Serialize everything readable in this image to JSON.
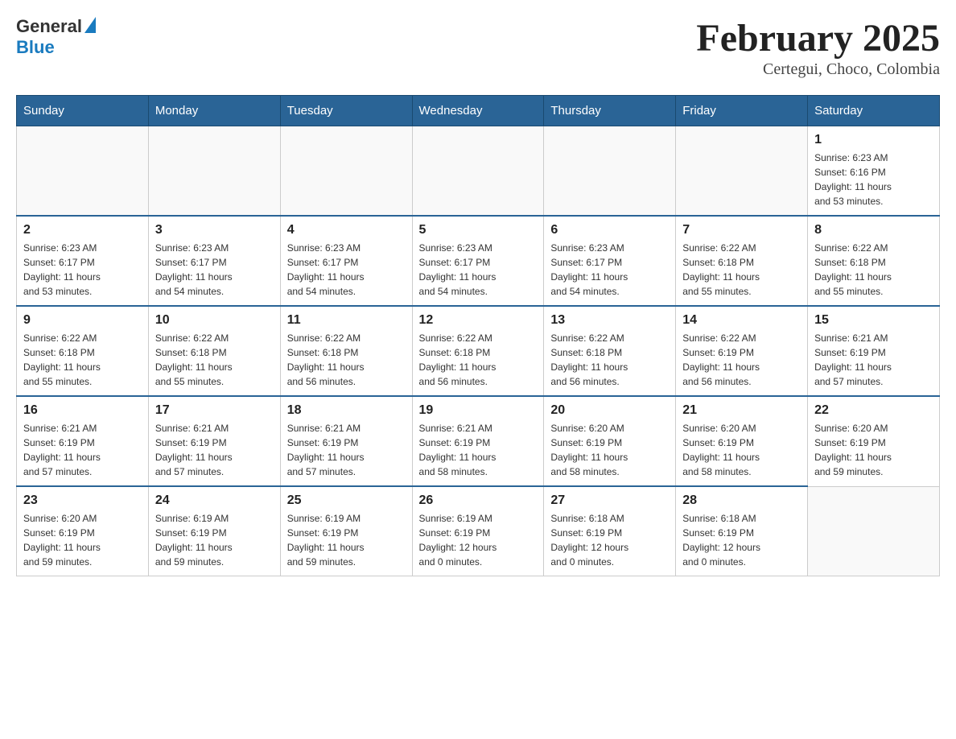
{
  "logo": {
    "general": "General",
    "blue": "Blue"
  },
  "title": "February 2025",
  "subtitle": "Certegui, Choco, Colombia",
  "weekdays": [
    "Sunday",
    "Monday",
    "Tuesday",
    "Wednesday",
    "Thursday",
    "Friday",
    "Saturday"
  ],
  "weeks": [
    [
      {
        "day": "",
        "info": ""
      },
      {
        "day": "",
        "info": ""
      },
      {
        "day": "",
        "info": ""
      },
      {
        "day": "",
        "info": ""
      },
      {
        "day": "",
        "info": ""
      },
      {
        "day": "",
        "info": ""
      },
      {
        "day": "1",
        "info": "Sunrise: 6:23 AM\nSunset: 6:16 PM\nDaylight: 11 hours\nand 53 minutes."
      }
    ],
    [
      {
        "day": "2",
        "info": "Sunrise: 6:23 AM\nSunset: 6:17 PM\nDaylight: 11 hours\nand 53 minutes."
      },
      {
        "day": "3",
        "info": "Sunrise: 6:23 AM\nSunset: 6:17 PM\nDaylight: 11 hours\nand 54 minutes."
      },
      {
        "day": "4",
        "info": "Sunrise: 6:23 AM\nSunset: 6:17 PM\nDaylight: 11 hours\nand 54 minutes."
      },
      {
        "day": "5",
        "info": "Sunrise: 6:23 AM\nSunset: 6:17 PM\nDaylight: 11 hours\nand 54 minutes."
      },
      {
        "day": "6",
        "info": "Sunrise: 6:23 AM\nSunset: 6:17 PM\nDaylight: 11 hours\nand 54 minutes."
      },
      {
        "day": "7",
        "info": "Sunrise: 6:22 AM\nSunset: 6:18 PM\nDaylight: 11 hours\nand 55 minutes."
      },
      {
        "day": "8",
        "info": "Sunrise: 6:22 AM\nSunset: 6:18 PM\nDaylight: 11 hours\nand 55 minutes."
      }
    ],
    [
      {
        "day": "9",
        "info": "Sunrise: 6:22 AM\nSunset: 6:18 PM\nDaylight: 11 hours\nand 55 minutes."
      },
      {
        "day": "10",
        "info": "Sunrise: 6:22 AM\nSunset: 6:18 PM\nDaylight: 11 hours\nand 55 minutes."
      },
      {
        "day": "11",
        "info": "Sunrise: 6:22 AM\nSunset: 6:18 PM\nDaylight: 11 hours\nand 56 minutes."
      },
      {
        "day": "12",
        "info": "Sunrise: 6:22 AM\nSunset: 6:18 PM\nDaylight: 11 hours\nand 56 minutes."
      },
      {
        "day": "13",
        "info": "Sunrise: 6:22 AM\nSunset: 6:18 PM\nDaylight: 11 hours\nand 56 minutes."
      },
      {
        "day": "14",
        "info": "Sunrise: 6:22 AM\nSunset: 6:19 PM\nDaylight: 11 hours\nand 56 minutes."
      },
      {
        "day": "15",
        "info": "Sunrise: 6:21 AM\nSunset: 6:19 PM\nDaylight: 11 hours\nand 57 minutes."
      }
    ],
    [
      {
        "day": "16",
        "info": "Sunrise: 6:21 AM\nSunset: 6:19 PM\nDaylight: 11 hours\nand 57 minutes."
      },
      {
        "day": "17",
        "info": "Sunrise: 6:21 AM\nSunset: 6:19 PM\nDaylight: 11 hours\nand 57 minutes."
      },
      {
        "day": "18",
        "info": "Sunrise: 6:21 AM\nSunset: 6:19 PM\nDaylight: 11 hours\nand 57 minutes."
      },
      {
        "day": "19",
        "info": "Sunrise: 6:21 AM\nSunset: 6:19 PM\nDaylight: 11 hours\nand 58 minutes."
      },
      {
        "day": "20",
        "info": "Sunrise: 6:20 AM\nSunset: 6:19 PM\nDaylight: 11 hours\nand 58 minutes."
      },
      {
        "day": "21",
        "info": "Sunrise: 6:20 AM\nSunset: 6:19 PM\nDaylight: 11 hours\nand 58 minutes."
      },
      {
        "day": "22",
        "info": "Sunrise: 6:20 AM\nSunset: 6:19 PM\nDaylight: 11 hours\nand 59 minutes."
      }
    ],
    [
      {
        "day": "23",
        "info": "Sunrise: 6:20 AM\nSunset: 6:19 PM\nDaylight: 11 hours\nand 59 minutes."
      },
      {
        "day": "24",
        "info": "Sunrise: 6:19 AM\nSunset: 6:19 PM\nDaylight: 11 hours\nand 59 minutes."
      },
      {
        "day": "25",
        "info": "Sunrise: 6:19 AM\nSunset: 6:19 PM\nDaylight: 11 hours\nand 59 minutes."
      },
      {
        "day": "26",
        "info": "Sunrise: 6:19 AM\nSunset: 6:19 PM\nDaylight: 12 hours\nand 0 minutes."
      },
      {
        "day": "27",
        "info": "Sunrise: 6:18 AM\nSunset: 6:19 PM\nDaylight: 12 hours\nand 0 minutes."
      },
      {
        "day": "28",
        "info": "Sunrise: 6:18 AM\nSunset: 6:19 PM\nDaylight: 12 hours\nand 0 minutes."
      },
      {
        "day": "",
        "info": ""
      }
    ]
  ]
}
